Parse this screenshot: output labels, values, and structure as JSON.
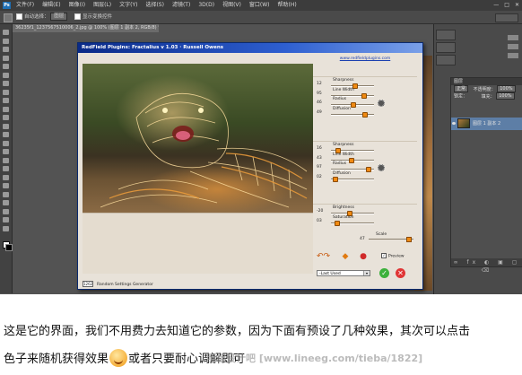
{
  "menubar": {
    "logo": "Ps",
    "items": [
      "文件(F)",
      "编辑(E)",
      "图像(I)",
      "图层(L)",
      "文字(Y)",
      "选择(S)",
      "滤镜(T)",
      "3D(D)",
      "视图(V)",
      "窗口(W)",
      "帮助(H)"
    ],
    "window_buttons": [
      "—",
      "□",
      "✕"
    ]
  },
  "options_bar": {
    "auto_select_label": "自动选择：",
    "auto_select_value": "图层",
    "show_transform_label": "显示变换控件"
  },
  "document": {
    "tab_title": "36235f1_1237567510006_2.jpg @ 100% (图层 1 副本 2, RGB/8) *"
  },
  "layers_panel": {
    "header": "图层",
    "mode": "正常",
    "opacity_label": "不透明度：",
    "opacity_value": "100%",
    "lock_label": "锁定：",
    "fill_label": "填充：",
    "fill_value": "100%",
    "layer_name": "图层 1 副本 2",
    "footer_icons": "∞ fx ◐ ▣ ▢ ⌫"
  },
  "dialog": {
    "title": "RedField Plugins: Fractalius v 1.03 · Russell Owens",
    "link": "www.redfieldplugins.com",
    "group1": [
      {
        "label": "Sharpness",
        "value": "12",
        "knob": 0.55
      },
      {
        "label": "Line Width",
        "value": "95",
        "knob": 0.78
      },
      {
        "label": "Radius",
        "value": "46",
        "knob": 0.5
      },
      {
        "label": "Diffusion",
        "value": "49",
        "knob": 0.8
      }
    ],
    "group2": [
      {
        "label": "Sharpness",
        "value": "16",
        "knob": 0.12
      },
      {
        "label": "Line Width",
        "value": "43",
        "knob": 0.45
      },
      {
        "label": "Radius",
        "value": "97",
        "knob": 0.88
      },
      {
        "label": "Diffusion",
        "value": "02",
        "knob": 0.05
      }
    ],
    "group3": [
      {
        "label": "Brightness",
        "value": "-20",
        "knob": 0.4
      },
      {
        "label": "Saturation",
        "value": "03",
        "knob": 0.1
      }
    ],
    "scale_label": "Scale",
    "scale_value": "47",
    "preview_label": "Preview",
    "preset": "-Last Used",
    "random_count": "1262",
    "random_label": "Random Settings Generator"
  },
  "caption": {
    "line1": "这是它的界面，我们不用费力去知道它的参数，因为下面有预设了几种效果，其次可以点击",
    "line2_a": "色子来随机获得效果",
    "line2_b": "或者只要耐心调解即可",
    "watermark": "照相设计吧 [www.lineeg.com/tieba/1822]"
  }
}
